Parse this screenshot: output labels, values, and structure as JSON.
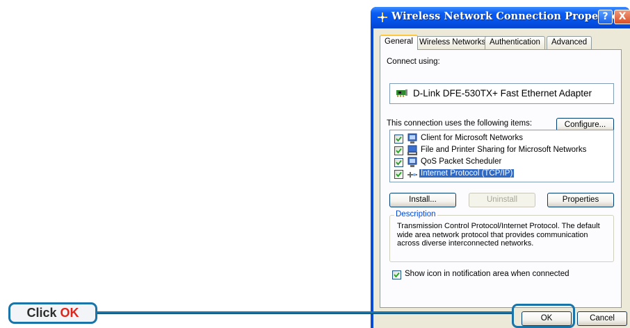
{
  "window": {
    "title": "Wireless Network Connection Properties",
    "help_glyph": "?",
    "close_glyph": "X"
  },
  "tabs": [
    {
      "label": "General",
      "active": true
    },
    {
      "label": "Wireless Networks",
      "active": false
    },
    {
      "label": "Authentication",
      "active": false
    },
    {
      "label": "Advanced",
      "active": false
    }
  ],
  "general": {
    "connect_using_label": "Connect using:",
    "adapter_name": "D-Link DFE-530TX+ Fast Ethernet Adapter",
    "configure_button": "Configure...",
    "items_label": "This connection uses the following items:",
    "items": [
      {
        "label": "Client for Microsoft Networks",
        "checked": true,
        "icon": "network-client-icon"
      },
      {
        "label": "File and Printer Sharing for Microsoft Networks",
        "checked": true,
        "icon": "file-printer-sharing-icon"
      },
      {
        "label": "QoS Packet Scheduler",
        "checked": true,
        "icon": "qos-scheduler-icon"
      },
      {
        "label": "Internet Protocol (TCP/IP)",
        "checked": true,
        "icon": "protocol-icon",
        "selected": true
      }
    ],
    "install_button": "Install...",
    "uninstall_button": "Uninstall",
    "properties_button": "Properties",
    "description_legend": "Description",
    "description_text": "Transmission Control Protocol/Internet Protocol. The default wide area network protocol that provides communication across diverse interconnected networks.",
    "show_icon_label": "Show icon in notification area when connected",
    "show_icon_checked": true
  },
  "footer": {
    "ok_button": "OK",
    "cancel_button": "Cancel"
  },
  "callout": {
    "click_text": "Click",
    "ok_text": "OK"
  },
  "colors": {
    "callout_border": "#1b74a8",
    "callout_ok_text": "#e2231a",
    "title_bar": "#0a5cf4",
    "selection": "#316ac5"
  }
}
